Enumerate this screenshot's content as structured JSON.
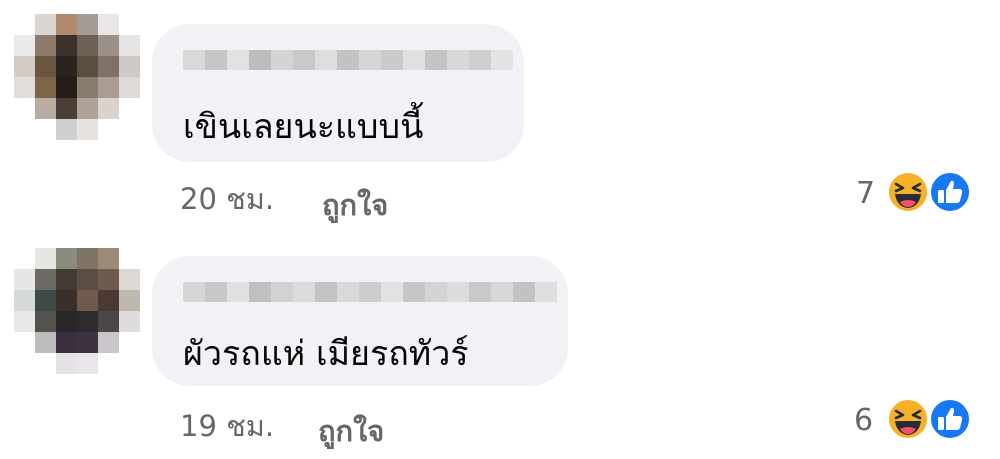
{
  "comments": [
    {
      "text": "เขินเลยนะแบบนี้",
      "time": "20 ชม.",
      "like_label": "ถูกใจ",
      "reaction_count": "7",
      "reactions": [
        "haha-icon",
        "like-icon"
      ]
    },
    {
      "text": "ผัวรถแห่ เมียรถทัวร์",
      "time": "19 ชม.",
      "like_label": "ถูกใจ",
      "reaction_count": "6",
      "reactions": [
        "haha-icon",
        "like-icon"
      ]
    }
  ],
  "colors": {
    "bubble": "#f0f2f5",
    "meta_text": "#65676b",
    "like_blue": "#1877f2",
    "haha_yellow": "#f7b125"
  }
}
